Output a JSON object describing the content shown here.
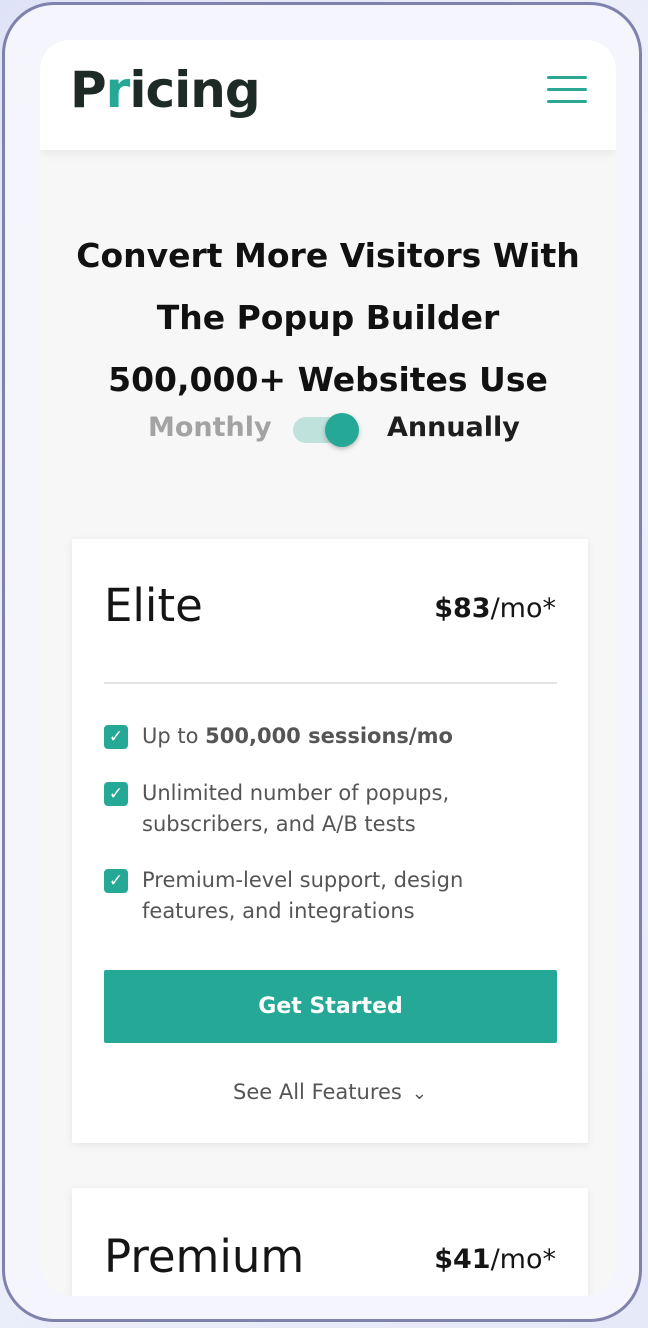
{
  "header": {
    "logo_before": "P",
    "logo_accent": "r",
    "logo_after": "icing",
    "menu_icon": "hamburger-icon"
  },
  "hero": {
    "line1": "Convert More Visitors With",
    "line2": "The Popup Builder",
    "line3": "500,000+ Websites Use"
  },
  "billing": {
    "monthly_label": "Monthly",
    "annually_label": "Annually",
    "selected": "Annually"
  },
  "plans": [
    {
      "name": "Elite",
      "price": "$83",
      "period": "/mo*",
      "features": [
        {
          "prefix": "Up to ",
          "bold": "500,000 sessions/mo",
          "suffix": ""
        },
        {
          "prefix": "Unlimited number of popups, subscribers, and A/B tests",
          "bold": "",
          "suffix": ""
        },
        {
          "prefix": "Premium-level support, design features, and integrations",
          "bold": "",
          "suffix": ""
        }
      ],
      "cta": "Get Started",
      "see_all": "See All Features"
    },
    {
      "name": "Premium",
      "price": "$41",
      "period": "/mo*"
    }
  ],
  "colors": {
    "accent": "#25a996",
    "toggle_track": "#bfe2dc",
    "frame_border": "#7e82ad"
  }
}
